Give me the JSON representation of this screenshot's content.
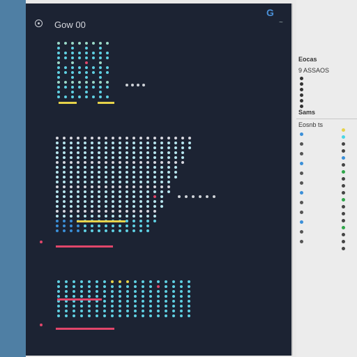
{
  "panel": {
    "title": "Gow 00",
    "top_right_mark": "G",
    "top_right_sub": "~"
  },
  "right_panel": {
    "header1": "Eocas",
    "header2": "9 ASSAOS",
    "header3": "Sams",
    "header4": "Eosnb ts"
  },
  "colors": {
    "panel_bg": "#1c2333",
    "accent_cyan": "#5fd1e3",
    "accent_red": "#e0466a",
    "accent_yellow": "#e6d24a",
    "accent_blue": "#3b8fd8",
    "strip": "#4f7fa4"
  }
}
